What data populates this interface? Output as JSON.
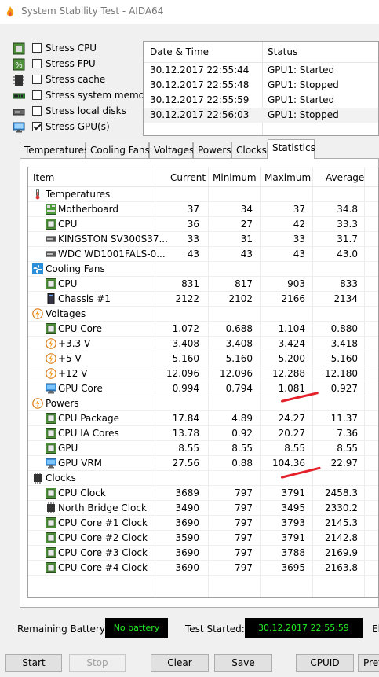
{
  "window": {
    "title": "System Stability Test - AIDA64"
  },
  "stress": [
    {
      "label": "Stress CPU",
      "checked": false,
      "icon": "cpu-chip-icon"
    },
    {
      "label": "Stress FPU",
      "checked": false,
      "icon": "percent-fpu-icon"
    },
    {
      "label": "Stress cache",
      "checked": false,
      "icon": "cache-chip-icon"
    },
    {
      "label": "Stress system memory",
      "checked": false,
      "icon": "memory-module-icon"
    },
    {
      "label": "Stress local disks",
      "checked": false,
      "icon": "disk-drive-icon"
    },
    {
      "label": "Stress GPU(s)",
      "checked": true,
      "icon": "gpu-monitor-icon"
    }
  ],
  "log": {
    "headers": [
      "Date & Time",
      "Status"
    ],
    "rows": [
      [
        "30.12.2017 22:55:44",
        "GPU1: Started"
      ],
      [
        "30.12.2017 22:55:48",
        "GPU1: Stopped"
      ],
      [
        "30.12.2017 22:55:59",
        "GPU1: Started"
      ],
      [
        "30.12.2017 22:56:03",
        "GPU1: Stopped"
      ]
    ]
  },
  "tabs": [
    "Temperatures",
    "Cooling Fans",
    "Voltages",
    "Powers",
    "Clocks",
    "Statistics"
  ],
  "active_tab": "Statistics",
  "stats": {
    "headers": [
      "Item",
      "Current",
      "Minimum",
      "Maximum",
      "Average"
    ],
    "rows": [
      {
        "type": "group",
        "label": "Temperatures",
        "icon": "thermometer-icon"
      },
      {
        "type": "item",
        "label": "Motherboard",
        "icon": "motherboard-icon",
        "v": [
          "37",
          "34",
          "37",
          "34.8"
        ]
      },
      {
        "type": "item",
        "label": "CPU",
        "icon": "cpu-icon",
        "v": [
          "36",
          "27",
          "42",
          "33.3"
        ]
      },
      {
        "type": "item",
        "label": "KINGSTON SV300S37...",
        "icon": "ssd-icon",
        "v": [
          "33",
          "31",
          "33",
          "31.7"
        ]
      },
      {
        "type": "item",
        "label": "WDC WD1001FALS-0...",
        "icon": "hdd-icon",
        "v": [
          "43",
          "43",
          "43",
          "43.0"
        ]
      },
      {
        "type": "group",
        "label": "Cooling Fans",
        "icon": "fan-icon"
      },
      {
        "type": "item",
        "label": "CPU",
        "icon": "cpu-icon",
        "v": [
          "831",
          "817",
          "903",
          "833"
        ]
      },
      {
        "type": "item",
        "label": "Chassis #1",
        "icon": "chassis-icon",
        "v": [
          "2122",
          "2102",
          "2166",
          "2134"
        ]
      },
      {
        "type": "group",
        "label": "Voltages",
        "icon": "lightning-icon"
      },
      {
        "type": "item",
        "label": "CPU Core",
        "icon": "cpu-icon",
        "v": [
          "1.072",
          "0.688",
          "1.104",
          "0.880"
        ]
      },
      {
        "type": "item",
        "label": "+3.3 V",
        "icon": "lightning-icon",
        "v": [
          "3.408",
          "3.408",
          "3.424",
          "3.418"
        ]
      },
      {
        "type": "item",
        "label": "+5 V",
        "icon": "lightning-icon",
        "v": [
          "5.160",
          "5.160",
          "5.200",
          "5.160"
        ]
      },
      {
        "type": "item",
        "label": "+12 V",
        "icon": "lightning-icon",
        "v": [
          "12.096",
          "12.096",
          "12.288",
          "12.180"
        ]
      },
      {
        "type": "item",
        "label": "GPU Core",
        "icon": "gpu-icon",
        "v": [
          "0.994",
          "0.794",
          "1.081",
          "0.927"
        ]
      },
      {
        "type": "group",
        "label": "Powers",
        "icon": "lightning-icon"
      },
      {
        "type": "item",
        "label": "CPU Package",
        "icon": "cpu-icon",
        "v": [
          "17.84",
          "4.89",
          "24.27",
          "11.37"
        ]
      },
      {
        "type": "item",
        "label": "CPU IA Cores",
        "icon": "cpu-icon",
        "v": [
          "13.78",
          "0.92",
          "20.27",
          "7.36"
        ]
      },
      {
        "type": "item",
        "label": "GPU",
        "icon": "cpu-icon",
        "v": [
          "8.55",
          "8.55",
          "8.55",
          "8.55"
        ]
      },
      {
        "type": "item",
        "label": "GPU VRM",
        "icon": "gpu-icon",
        "v": [
          "27.56",
          "0.88",
          "104.36",
          "22.97"
        ]
      },
      {
        "type": "group",
        "label": "Clocks",
        "icon": "clock-chip-icon"
      },
      {
        "type": "item",
        "label": "CPU Clock",
        "icon": "cpu-icon",
        "v": [
          "3689",
          "797",
          "3791",
          "2458.3"
        ]
      },
      {
        "type": "item",
        "label": "North Bridge Clock",
        "icon": "chip-icon",
        "v": [
          "3490",
          "797",
          "3495",
          "2330.2"
        ]
      },
      {
        "type": "item",
        "label": "CPU Core #1 Clock",
        "icon": "cpu-icon",
        "v": [
          "3690",
          "797",
          "3793",
          "2145.3"
        ]
      },
      {
        "type": "item",
        "label": "CPU Core #2 Clock",
        "icon": "cpu-icon",
        "v": [
          "3590",
          "797",
          "3791",
          "2142.8"
        ]
      },
      {
        "type": "item",
        "label": "CPU Core #3 Clock",
        "icon": "cpu-icon",
        "v": [
          "3690",
          "797",
          "3788",
          "2169.9"
        ]
      },
      {
        "type": "item",
        "label": "CPU Core #4 Clock",
        "icon": "cpu-icon",
        "v": [
          "3690",
          "797",
          "3695",
          "2163.8"
        ]
      }
    ]
  },
  "status_bar": {
    "battery_label": "Remaining Battery:",
    "battery_value": "No battery",
    "started_label": "Test Started:",
    "started_value": "30.12.2017 22:55:59",
    "elapsed_label": "El"
  },
  "buttons": {
    "start": "Start",
    "stop": "Stop",
    "clear": "Clear",
    "save": "Save",
    "cpuid": "CPUID",
    "prefs": "Pref"
  },
  "colors": {
    "lcd_text": "#22ee22",
    "annotation": "#e5202a"
  }
}
